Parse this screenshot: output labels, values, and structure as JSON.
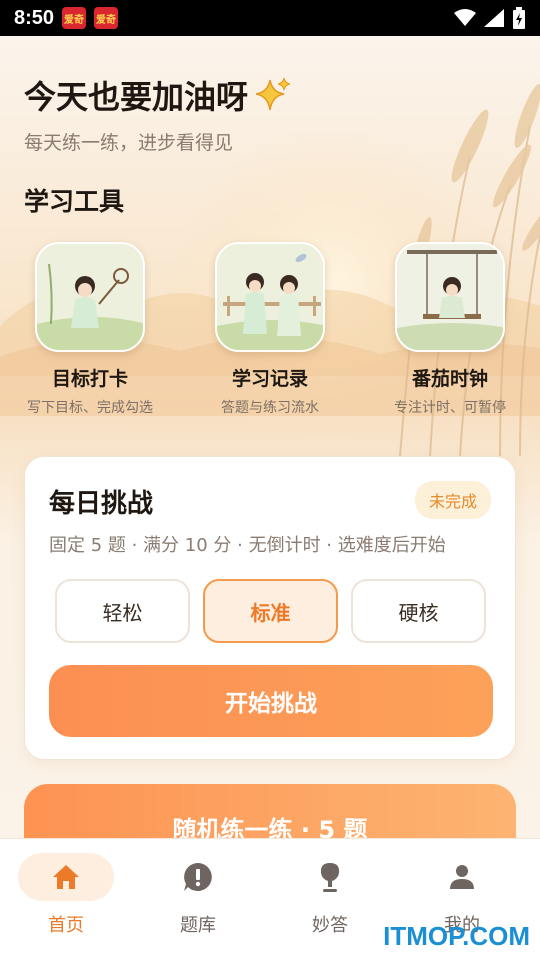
{
  "status_bar": {
    "time": "8:50",
    "notif_1": "爱奇",
    "notif_2": "爱奇"
  },
  "header": {
    "title": "今天也要加油呀",
    "subtitle": "每天练一练，进步看得见"
  },
  "tools_section": {
    "title": "学习工具",
    "items": [
      {
        "label": "目标打卡",
        "desc": "写下目标、完成勾选"
      },
      {
        "label": "学习记录",
        "desc": "答题与练习流水"
      },
      {
        "label": "番茄时钟",
        "desc": "专注计时、可暂停"
      }
    ]
  },
  "challenge": {
    "title": "每日挑战",
    "badge": "未完成",
    "desc": "固定 5 题 · 满分 10 分 · 无倒计时 · 选难度后开始",
    "levels": [
      "轻松",
      "标准",
      "硬核"
    ],
    "selected_level": "标准",
    "start_label": "开始挑战"
  },
  "random_practice": {
    "label": "随机练一练 · 5 题"
  },
  "tabbar": {
    "items": [
      {
        "label": "首页",
        "icon": "home-icon"
      },
      {
        "label": "题库",
        "icon": "exclamation-icon"
      },
      {
        "label": "妙答",
        "icon": "pin-icon"
      },
      {
        "label": "我的",
        "icon": "user-icon"
      }
    ],
    "active": "首页"
  },
  "watermark": "ITMOP.COM",
  "colors": {
    "accent": "#ec7a28",
    "button": "#fb8f52",
    "badge_bg": "#fdf0d8"
  }
}
